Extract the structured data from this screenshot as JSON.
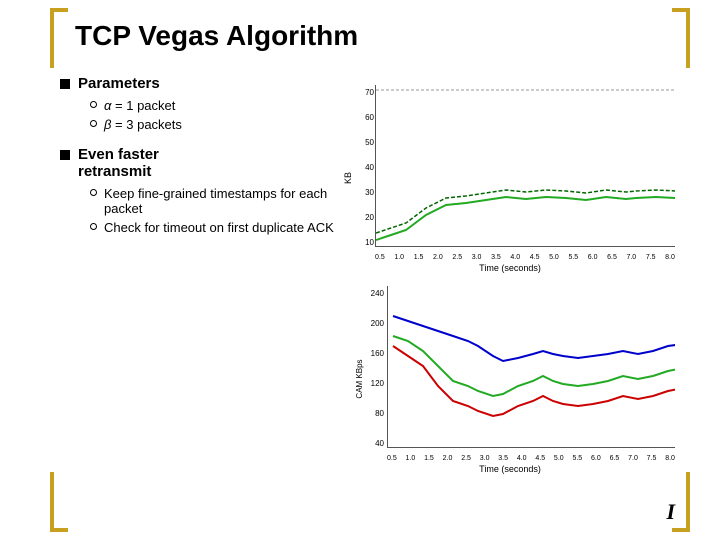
{
  "page": {
    "title": "TCP Vegas Algorithm",
    "brackets_color": "#c8a020"
  },
  "content": {
    "section1": {
      "label": "Parameters",
      "items": [
        {
          "text": "α = 1 packet"
        },
        {
          "text": "β = 3 packets"
        }
      ]
    },
    "section2": {
      "label": "Even faster retransmit",
      "items": [
        {
          "text": "Keep fine-grained timestamps for each packet"
        },
        {
          "text": "Check for timeout on first duplicate ACK"
        }
      ]
    }
  },
  "chart1": {
    "ylabel": "KB",
    "xlabel": "Time (seconds)",
    "yticks": [
      "70",
      "60",
      "50",
      "40",
      "30",
      "20",
      "10"
    ],
    "xticks": [
      "0.5",
      "1.0",
      "1.5",
      "2.0",
      "2.5",
      "3.0",
      "3.5",
      "4.0",
      "4.5",
      "5.0",
      "5.5",
      "6.0",
      "6.5",
      "7.0",
      "7.5",
      "8.0"
    ]
  },
  "chart2": {
    "ylabel": "CAM KBps",
    "xlabel": "Time (seconds)",
    "yticks": [
      "240",
      "200",
      "160",
      "120",
      "80",
      "40"
    ],
    "xticks": [
      "0.5",
      "1.0",
      "1.5",
      "2.0",
      "2.5",
      "3.0",
      "3.5",
      "4.0",
      "4.5",
      "5.0",
      "5.5",
      "6.0",
      "6.5",
      "7.0",
      "7.5",
      "8.0"
    ]
  },
  "footer_icon": "I"
}
